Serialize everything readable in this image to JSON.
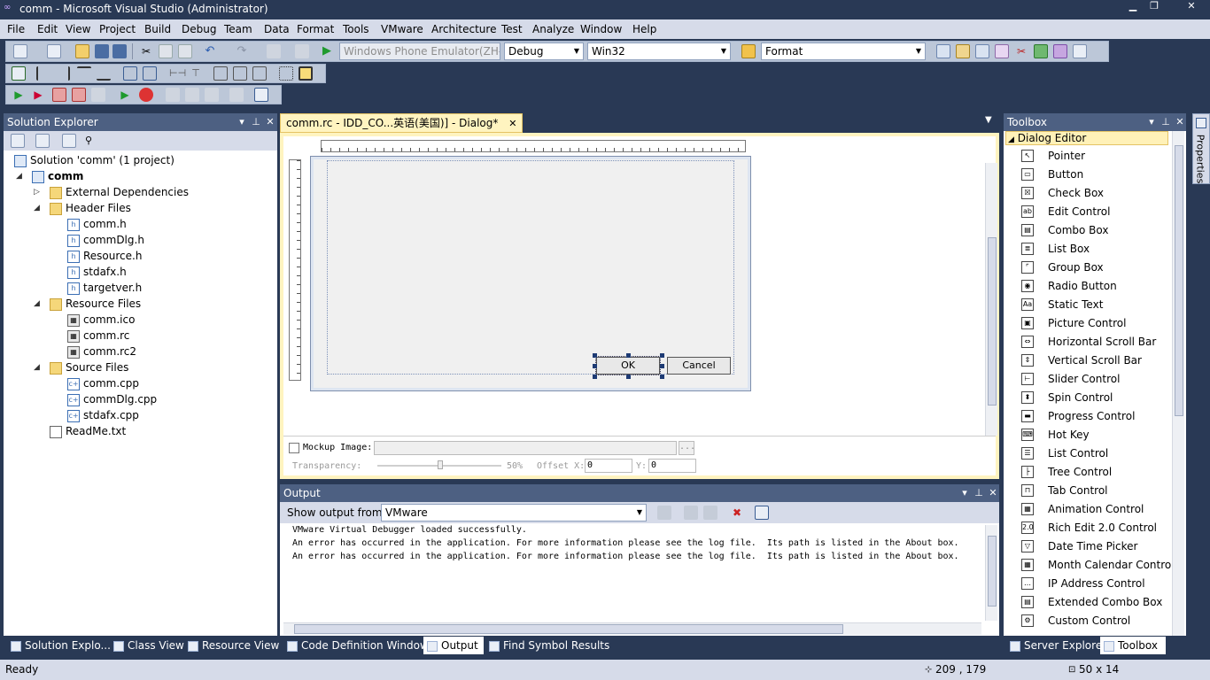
{
  "window": {
    "title": "comm - Microsoft Visual Studio (Administrator)"
  },
  "menu": [
    "File",
    "Edit",
    "View",
    "Project",
    "Build",
    "Debug",
    "Team",
    "Data",
    "Format",
    "Tools",
    "VMware",
    "Architecture",
    "Test",
    "Analyze",
    "Window",
    "Help"
  ],
  "toolbar": {
    "emulator": "Windows Phone Emulator(ZH-",
    "config": "Debug",
    "platform": "Win32",
    "find": "Format"
  },
  "solution_explorer": {
    "title": "Solution Explorer",
    "solution": "Solution 'comm' (1 project)",
    "project": "comm",
    "items": [
      {
        "label": "External Dependencies",
        "type": "folder",
        "indent": 1,
        "toggle": "▷"
      },
      {
        "label": "Header Files",
        "type": "folder",
        "indent": 1,
        "toggle": "◢"
      },
      {
        "label": "comm.h",
        "type": "hdr",
        "indent": 2
      },
      {
        "label": "commDlg.h",
        "type": "hdr",
        "indent": 2
      },
      {
        "label": "Resource.h",
        "type": "hdr",
        "indent": 2
      },
      {
        "label": "stdafx.h",
        "type": "hdr",
        "indent": 2
      },
      {
        "label": "targetver.h",
        "type": "hdr",
        "indent": 2
      },
      {
        "label": "Resource Files",
        "type": "folder",
        "indent": 1,
        "toggle": "◢"
      },
      {
        "label": "comm.ico",
        "type": "res",
        "indent": 2
      },
      {
        "label": "comm.rc",
        "type": "res",
        "indent": 2
      },
      {
        "label": "comm.rc2",
        "type": "res",
        "indent": 2
      },
      {
        "label": "Source Files",
        "type": "folder",
        "indent": 1,
        "toggle": "◢"
      },
      {
        "label": "comm.cpp",
        "type": "cpp",
        "indent": 2
      },
      {
        "label": "commDlg.cpp",
        "type": "cpp",
        "indent": 2
      },
      {
        "label": "stdafx.cpp",
        "type": "cpp",
        "indent": 2
      },
      {
        "label": "ReadMe.txt",
        "type": "txt",
        "indent": 1
      }
    ]
  },
  "editor": {
    "tab": "comm.rc - IDD_CO...英语(美国)] - Dialog*",
    "ok": "OK",
    "cancel": "Cancel",
    "mockup_label": "Mockup Image:",
    "browse": "...",
    "transparency_label": "Transparency:",
    "transparency_value": "50%",
    "offsetx_label": "Offset X:",
    "offsetx_value": "0",
    "y_label": "Y:",
    "y_value": "0"
  },
  "output": {
    "title": "Output",
    "show_label": "Show output from:",
    "source": "VMware",
    "lines": [
      "VMware Virtual Debugger loaded successfully.",
      "An error has occurred in the application. For more information please see the log file.  Its path is listed in the About box.",
      "An error has occurred in the application. For more information please see the log file.  Its path is listed in the About box."
    ]
  },
  "toolbox": {
    "title": "Toolbox",
    "group": "Dialog Editor",
    "items": [
      {
        "label": "Pointer",
        "icon": "pointer-icon",
        "g": "↖"
      },
      {
        "label": "Button",
        "icon": "button-icon",
        "g": "▭"
      },
      {
        "label": "Check Box",
        "icon": "check-box-icon",
        "g": "☒"
      },
      {
        "label": "Edit Control",
        "icon": "edit-control-icon",
        "g": "ab"
      },
      {
        "label": "Combo Box",
        "icon": "combo-box-icon",
        "g": "▤"
      },
      {
        "label": "List Box",
        "icon": "list-box-icon",
        "g": "≣"
      },
      {
        "label": "Group Box",
        "icon": "group-box-icon",
        "g": "⌜"
      },
      {
        "label": "Radio Button",
        "icon": "radio-button-icon",
        "g": "◉"
      },
      {
        "label": "Static Text",
        "icon": "static-text-icon",
        "g": "Aa"
      },
      {
        "label": "Picture Control",
        "icon": "picture-control-icon",
        "g": "▣"
      },
      {
        "label": "Horizontal Scroll Bar",
        "icon": "horizontal-scroll-bar-icon",
        "g": "⇔"
      },
      {
        "label": "Vertical Scroll Bar",
        "icon": "vertical-scroll-bar-icon",
        "g": "⇕"
      },
      {
        "label": "Slider Control",
        "icon": "slider-control-icon",
        "g": "⊢"
      },
      {
        "label": "Spin Control",
        "icon": "spin-control-icon",
        "g": "⬍"
      },
      {
        "label": "Progress Control",
        "icon": "progress-control-icon",
        "g": "▬"
      },
      {
        "label": "Hot Key",
        "icon": "hot-key-icon",
        "g": "⌨"
      },
      {
        "label": "List Control",
        "icon": "list-control-icon",
        "g": "☰"
      },
      {
        "label": "Tree Control",
        "icon": "tree-control-icon",
        "g": "├"
      },
      {
        "label": "Tab Control",
        "icon": "tab-control-icon",
        "g": "⊓"
      },
      {
        "label": "Animation Control",
        "icon": "animation-control-icon",
        "g": "▦"
      },
      {
        "label": "Rich Edit 2.0 Control",
        "icon": "rich-edit-icon",
        "g": "2.0"
      },
      {
        "label": "Date Time Picker",
        "icon": "date-time-picker-icon",
        "g": "▽"
      },
      {
        "label": "Month Calendar Control",
        "icon": "month-calendar-icon",
        "g": "▦"
      },
      {
        "label": "IP Address Control",
        "icon": "ip-address-icon",
        "g": "…"
      },
      {
        "label": "Extended Combo Box",
        "icon": "extended-combo-box-icon",
        "g": "▤"
      },
      {
        "label": "Custom Control",
        "icon": "custom-control-icon",
        "g": "⚙"
      }
    ]
  },
  "side_tab": "Properties",
  "bottom_tabs": {
    "left": [
      "Solution Explo...",
      "Class View",
      "Resource View",
      "Code Definition Window",
      "Output",
      "Find Symbol Results"
    ],
    "right": [
      "Server Explorer",
      "Toolbox"
    ]
  },
  "status": {
    "text": "Ready",
    "position": "209 , 179",
    "size": "50 x 14"
  }
}
